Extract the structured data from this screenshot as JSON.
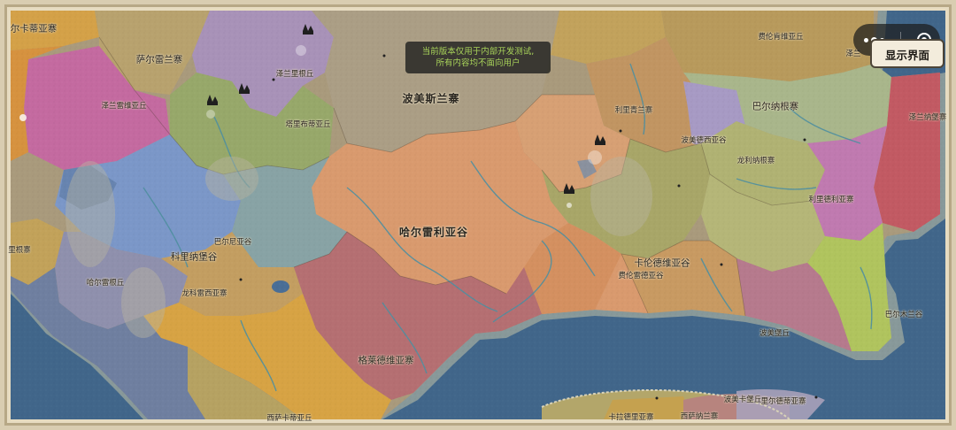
{
  "notice": {
    "line1": "当前版本仅用于内部开发测试,",
    "line2": "所有内容均不面向用户"
  },
  "show_ui_button": {
    "label": "显示界面"
  },
  "map_labels": {
    "a": "尔卡蒂亚寨",
    "b": "萨尔雷兰寨",
    "c": "泽兰里根丘",
    "d": "泽兰雷维亚丘",
    "e": "塔里布蒂亚丘",
    "f": "波美斯兰寨",
    "g": "费伦肯维亚丘",
    "h": "泽兰",
    "i": "利里青兰寨",
    "j": "巴尔纳根寨",
    "k": "泽兰纳堡寨",
    "l": "波美德西亚谷",
    "m": "龙利纳根寨",
    "n": "利里德利亚寨",
    "o": "哈尔雷利亚谷",
    "p": "巴尔尼亚谷",
    "q": "里根寨",
    "r": "科里纳堡谷",
    "s": "卡伦德维亚谷",
    "t": "费伦雷德亚谷",
    "u": "哈尔雷根丘",
    "v": "龙科雷西亚寨",
    "w": "巴尔木兰谷",
    "x": "波美堡丘",
    "y": "格莱德维亚寨",
    "z": "波美卡堡丘",
    "z2": "里尔德蒂亚寨",
    "z3": "卡拉德里亚寨",
    "z4": "西萨纳兰寨",
    "z5": "西萨卡蒂亚丘"
  },
  "colors": {
    "sea": "#41668a",
    "notice_text": "#a9d45a",
    "frame": "#d9cdb1"
  },
  "icons": [
    "more-dots-icon",
    "target-circle-icon",
    "castle-icon"
  ]
}
